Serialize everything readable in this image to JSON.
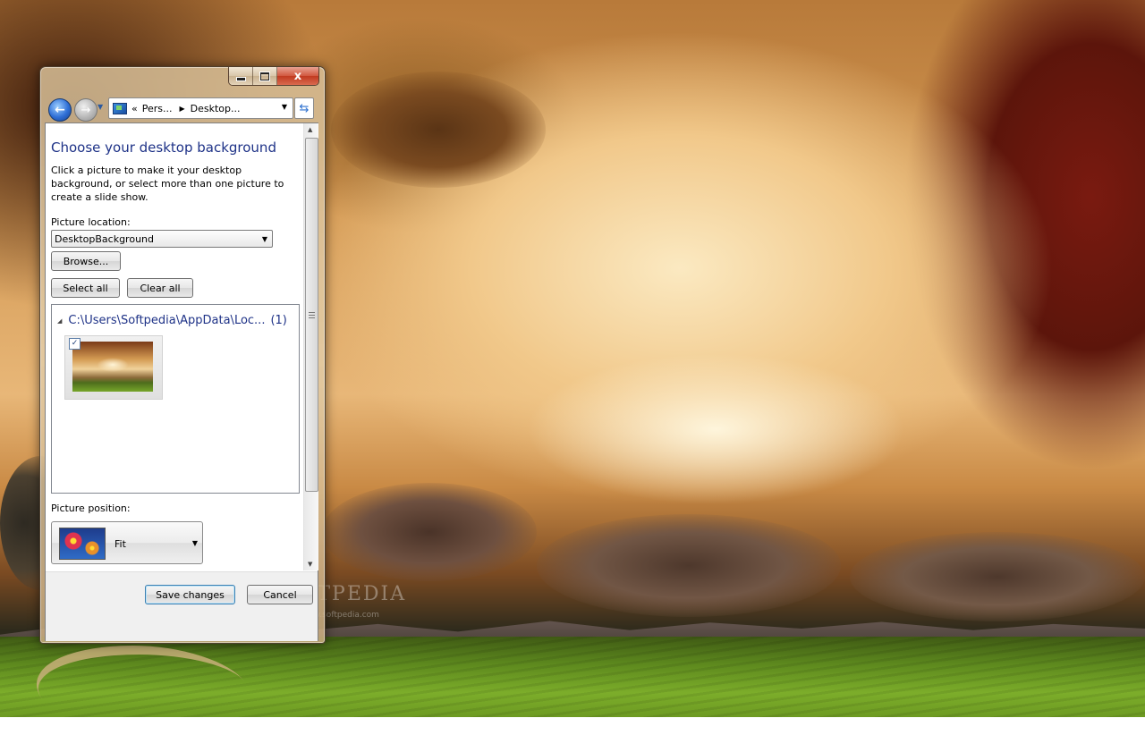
{
  "desktop": {
    "watermark": "SOFTPEDIA",
    "watermark_url": "www.softpedia.com"
  },
  "window": {
    "caption_buttons": {
      "minimize": "minimize-icon",
      "maximize": "maximize-icon",
      "close_label": "x"
    },
    "nav": {
      "back_icon": "arrow-left-icon",
      "forward_icon": "arrow-right-icon",
      "refresh_icon": "refresh-icon"
    },
    "address": {
      "overflow": "«",
      "crumb_1": "Pers...",
      "crumb_2": "Desktop..."
    },
    "content": {
      "title": "Choose your desktop background",
      "description": "Click a picture to make it your desktop background, or select more than one picture to create a slide show.",
      "location_label": "Picture location:",
      "location_value": "DesktopBackground",
      "browse_label": "Browse...",
      "select_all_label": "Select all",
      "clear_all_label": "Clear all",
      "group_path": "C:\\Users\\Softpedia\\AppData\\Loc...",
      "group_count": "(1)",
      "thumbnail_checked": "✓",
      "position_label": "Picture position:",
      "position_value": "Fit"
    },
    "footer": {
      "save_label": "Save changes",
      "cancel_label": "Cancel"
    }
  }
}
